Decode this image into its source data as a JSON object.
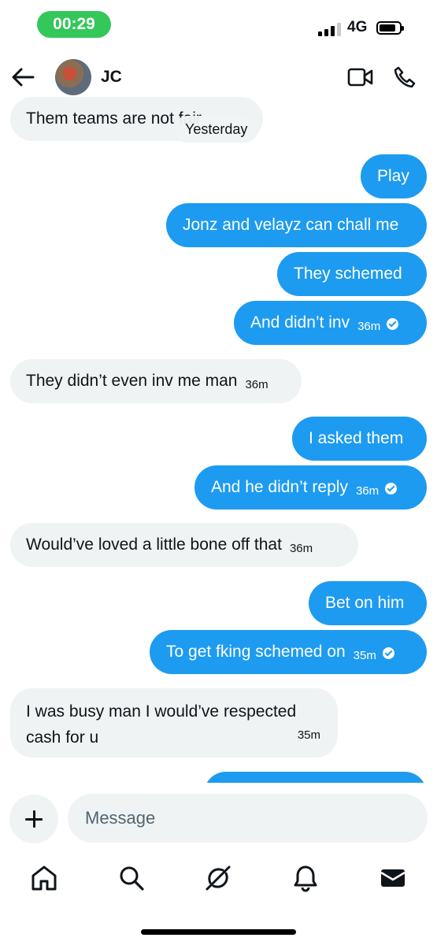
{
  "status_bar": {
    "time": "00:29",
    "network": "4G"
  },
  "header": {
    "contact_name": "JC"
  },
  "divider": {
    "label": "Yesterday"
  },
  "messages": [
    {
      "dir": "in",
      "text": "Them teams are not fair"
    },
    {
      "dir": "out",
      "text": "Play"
    },
    {
      "dir": "out",
      "text": "Jonz and velayz can chall me"
    },
    {
      "dir": "out",
      "text": "They schemed"
    },
    {
      "dir": "out",
      "text": "And didn’t inv",
      "time": "36m",
      "read": true
    },
    {
      "dir": "in",
      "text": "They didn’t even inv me man",
      "time": "36m"
    },
    {
      "dir": "out",
      "text": "I asked them"
    },
    {
      "dir": "out",
      "text": "And he didn’t reply",
      "time": "36m",
      "read": true
    },
    {
      "dir": "in",
      "text": "Would’ve loved a little bone off that",
      "time": "36m"
    },
    {
      "dir": "out",
      "text": "Bet on him"
    },
    {
      "dir": "out",
      "text": "To get fking schemed on",
      "time": "35m",
      "read": true
    },
    {
      "dir": "in",
      "text": "I was busy man I would’ve respected cash for u",
      "time": "35m"
    }
  ],
  "composer": {
    "placeholder": "Message"
  },
  "nav": [
    "home-icon",
    "search-icon",
    "grok-icon",
    "notifications-icon",
    "messages-icon"
  ]
}
